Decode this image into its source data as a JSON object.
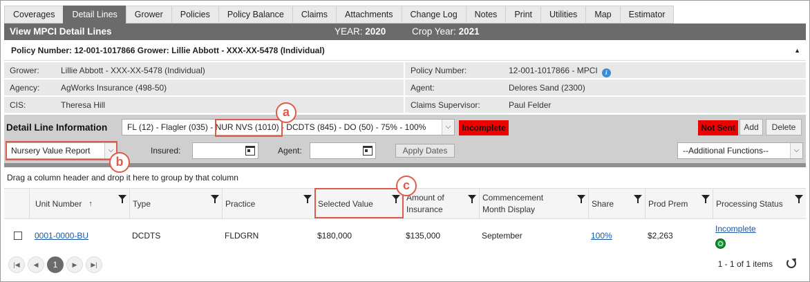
{
  "tabs": [
    "Coverages",
    "Detail Lines",
    "Grower",
    "Policies",
    "Policy Balance",
    "Claims",
    "Attachments",
    "Change Log",
    "Notes",
    "Print",
    "Utilities",
    "Map",
    "Estimator"
  ],
  "active_tab": "Detail Lines",
  "title": "View MPCI Detail Lines",
  "year_label": "YEAR:",
  "year_value": "2020",
  "crop_year_label": "Crop Year:",
  "crop_year_value": "2021",
  "policy_header": "Policy Number: 12-001-1017866 Grower: Lillie Abbott - XXX-XX-5478 (Individual)",
  "info": {
    "grower_label": "Grower:",
    "grower_value": "Lillie Abbott - XXX-XX-5478 (Individual)",
    "policy_label": "Policy Number:",
    "policy_value": "12-001-1017866 - MPCI",
    "agency_label": "Agency:",
    "agency_value": "AgWorks Insurance (498-50)",
    "agent_label": "Agent:",
    "agent_value": "Delores Sand (2300)",
    "cis_label": "CIS:",
    "cis_value": "Theresa Hill",
    "claims_label": "Claims Supervisor:",
    "claims_value": "Paul Felder"
  },
  "detail": {
    "title": "Detail Line Information",
    "line_select": "FL (12) - Flagler (035) - NUR NVS (1010) - DCDTS (845) - DO (50) - 75% - 100%",
    "status": "Incomplete",
    "not_sent": "Not Sent",
    "add": "Add",
    "delete": "Delete",
    "report_select": "Nursery Value Report",
    "insured_label": "Insured:",
    "agent_label": "Agent:",
    "apply_dates": "Apply Dates",
    "additional": "--Additional Functions--"
  },
  "group_hint": "Drag a column header and drop it here to group by that column",
  "columns": {
    "unit": "Unit Number",
    "type": "Type",
    "practice": "Practice",
    "selected": "Selected Value",
    "amount_line1": "Amount of",
    "amount_line2": "Insurance",
    "comm_line1": "Commencement",
    "comm_line2": "Month Display",
    "share": "Share",
    "prem": "Prod Prem",
    "status": "Processing Status"
  },
  "row": {
    "unit": "0001-0000-BU",
    "type": "DCDTS",
    "practice": "FLDGRN",
    "selected": "$180,000",
    "amount": "$135,000",
    "comm": "September",
    "share": "100%",
    "prem": "$2,263",
    "status": "Incomplete"
  },
  "pager": {
    "current": "1",
    "summary": "1 - 1 of 1 items"
  },
  "annotations": [
    "a",
    "b",
    "c"
  ],
  "colors": {
    "accent_red": "#ee0000",
    "annotation": "#e05a4a",
    "header_gray": "#6b6b6b"
  }
}
